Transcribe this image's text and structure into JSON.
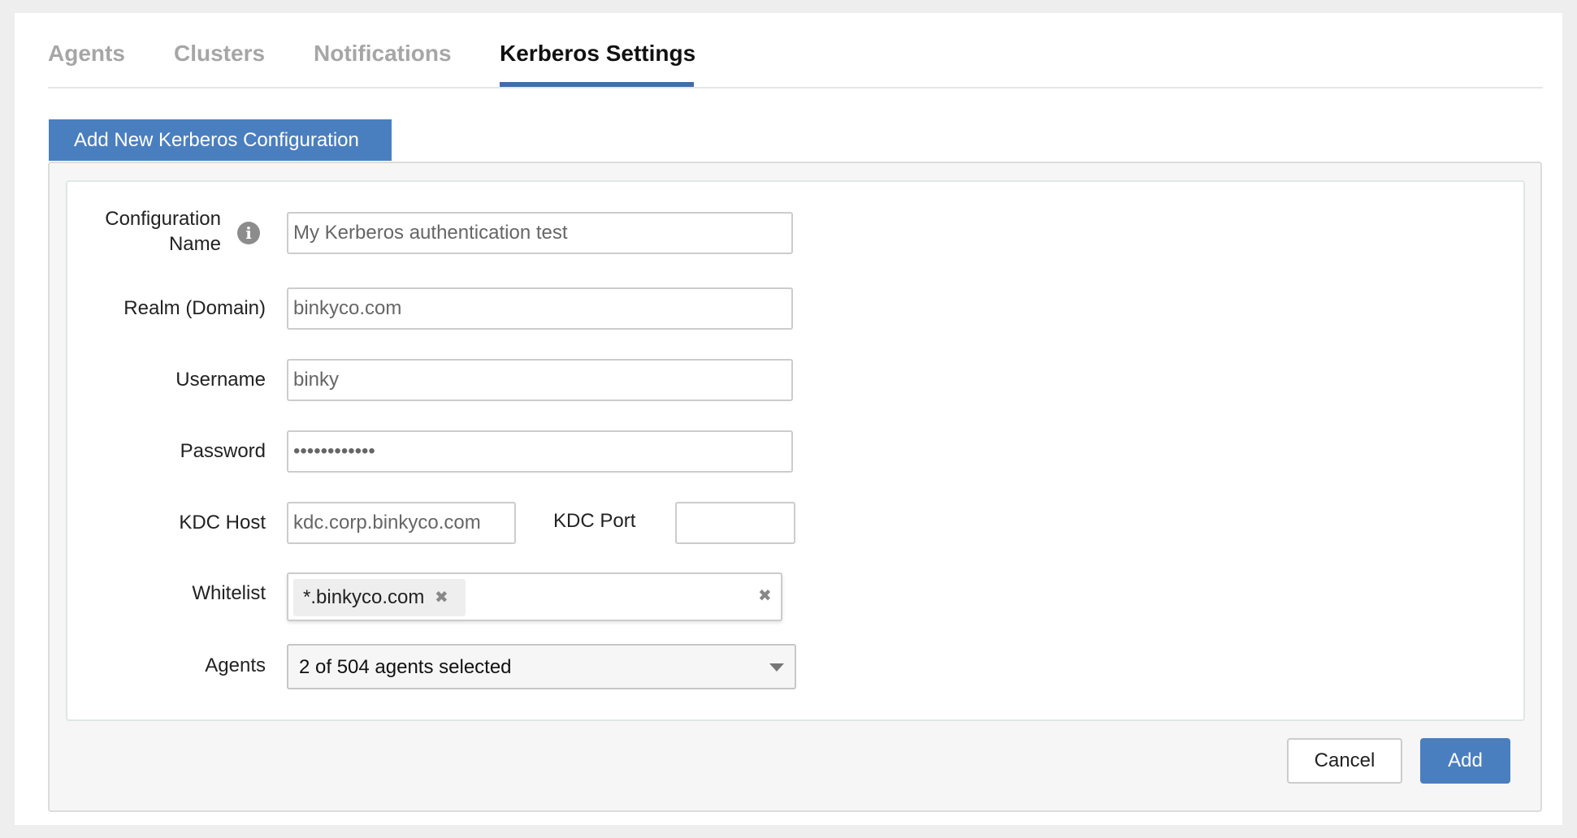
{
  "tabs": [
    {
      "label": "Agents",
      "active": false
    },
    {
      "label": "Clusters",
      "active": false
    },
    {
      "label": "Notifications",
      "active": false
    },
    {
      "label": "Kerberos Settings",
      "active": true
    }
  ],
  "section": {
    "title": "Add New Kerberos Configuration"
  },
  "form": {
    "config_name": {
      "label_line1": "Configuration",
      "label_line2": "Name",
      "value": "My Kerberos authentication test",
      "info_icon": "info-icon"
    },
    "realm": {
      "label": "Realm (Domain)",
      "value": "binkyco.com"
    },
    "username": {
      "label": "Username",
      "value": "binky"
    },
    "password": {
      "label": "Password",
      "value": "mypassword12"
    },
    "kdc_host": {
      "label": "KDC Host",
      "value": "kdc.corp.binkyco.com"
    },
    "kdc_port": {
      "label": "KDC Port",
      "value": ""
    },
    "whitelist": {
      "label": "Whitelist",
      "chips": [
        "*.binkyco.com"
      ],
      "remove_icon": "close-icon",
      "clear_icon": "close-icon"
    },
    "agents": {
      "label": "Agents",
      "selected": "2 of 504 agents selected",
      "icon": "chevron-down-icon"
    }
  },
  "buttons": {
    "cancel": "Cancel",
    "add": "Add"
  },
  "colors": {
    "accent": "#4a7fbf",
    "tab_underline": "#3f6ea8",
    "tab_inactive": "#a6a6a6"
  }
}
